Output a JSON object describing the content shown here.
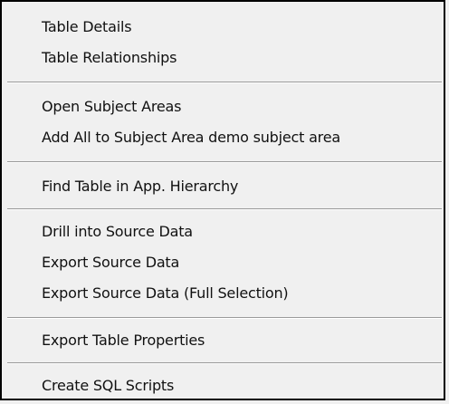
{
  "context_menu": {
    "items": [
      {
        "label": "Table Details"
      },
      {
        "label": "Table Relationships"
      },
      {
        "label": "Open Subject Areas"
      },
      {
        "label": "Add All to Subject Area demo subject area"
      },
      {
        "label": "Find Table in App. Hierarchy"
      },
      {
        "label": "Drill into Source Data"
      },
      {
        "label": "Export Source Data"
      },
      {
        "label": "Export Source Data (Full Selection)"
      },
      {
        "label": "Export Table Properties"
      },
      {
        "label": "Create SQL Scripts"
      }
    ]
  }
}
